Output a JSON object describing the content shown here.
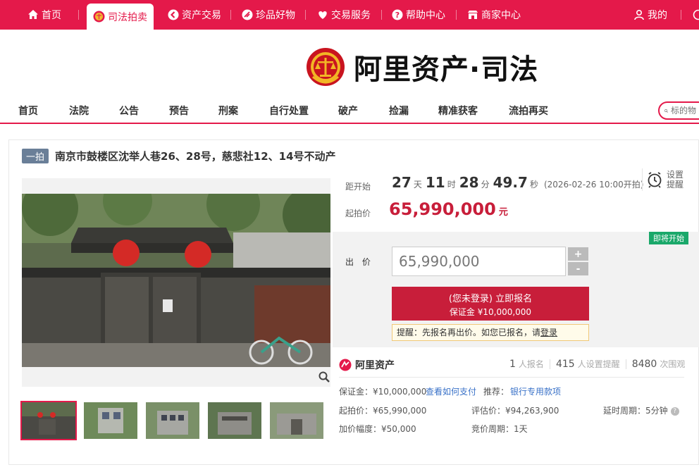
{
  "top_nav": [
    {
      "label": "首页",
      "icon": "home-icon"
    },
    {
      "label": "司法拍卖",
      "icon": "court-emblem-icon",
      "active": true
    },
    {
      "label": "资产交易",
      "icon": "asset-trade-icon"
    },
    {
      "label": "珍品好物",
      "icon": "treasure-icon"
    },
    {
      "label": "交易服务",
      "icon": "heart-icon"
    },
    {
      "label": "帮助中心",
      "icon": "question-icon"
    },
    {
      "label": "商家中心",
      "icon": "shop-icon"
    }
  ],
  "user": {
    "label": "我的",
    "icon": "user-icon"
  },
  "logo": {
    "text": "阿里资产·司法"
  },
  "sub_nav": [
    "首页",
    "法院",
    "公告",
    "预告",
    "刑案",
    "自行处置",
    "破产",
    "捡漏",
    "精准获客",
    "流拍再买"
  ],
  "search": {
    "placeholder": "标的物"
  },
  "item": {
    "round_tag": "一拍",
    "title": "南京市鼓楼区沈举人巷26、28号，慈悲社12、14号不动产"
  },
  "countdown": {
    "label": "距开始",
    "days": "27",
    "days_unit": "天",
    "hours": "11",
    "hours_unit": "时",
    "minutes": "28",
    "minutes_unit": "分",
    "seconds": "49.7",
    "seconds_unit": "秒",
    "start_note": "(2026-02-26 10:00开拍)"
  },
  "reminder": {
    "label": "设置提醒"
  },
  "start_price": {
    "label": "起拍价",
    "value": "65,990,000",
    "unit": "元"
  },
  "bid": {
    "badge": "即将开始",
    "label": "出 价",
    "value": "65,990,000",
    "plus": "+",
    "minus": "-",
    "signup_line1": "(您未登录) 立即报名",
    "signup_line2": "保证金 ¥10,000,000",
    "hint_prefix": "提醒：先报名再出价。如您已报名，请",
    "hint_link": "登录"
  },
  "platform": {
    "name": "阿里资产"
  },
  "stats": [
    {
      "num": "1",
      "label": "人报名"
    },
    {
      "num": "415",
      "label": "人设置提醒"
    },
    {
      "num": "8480",
      "label": "次围观"
    }
  ],
  "details": {
    "deposit": "保证金：¥10,000,000",
    "how_to_pay": "查看如何支付",
    "recommend_label": "推荐：",
    "recommend_link": "银行专用款项",
    "start_price": "起拍价：¥65,990,000",
    "appraisal": "评估价：¥94,263,900",
    "delay": "延时周期：5分钟",
    "increment": "加价幅度：¥50,000",
    "bid_period": "竞价周期：1天"
  },
  "colors": {
    "brand": "#e4194a",
    "price": "#c81e3a",
    "badge": "#1aa86a",
    "link": "#3a72c8"
  }
}
